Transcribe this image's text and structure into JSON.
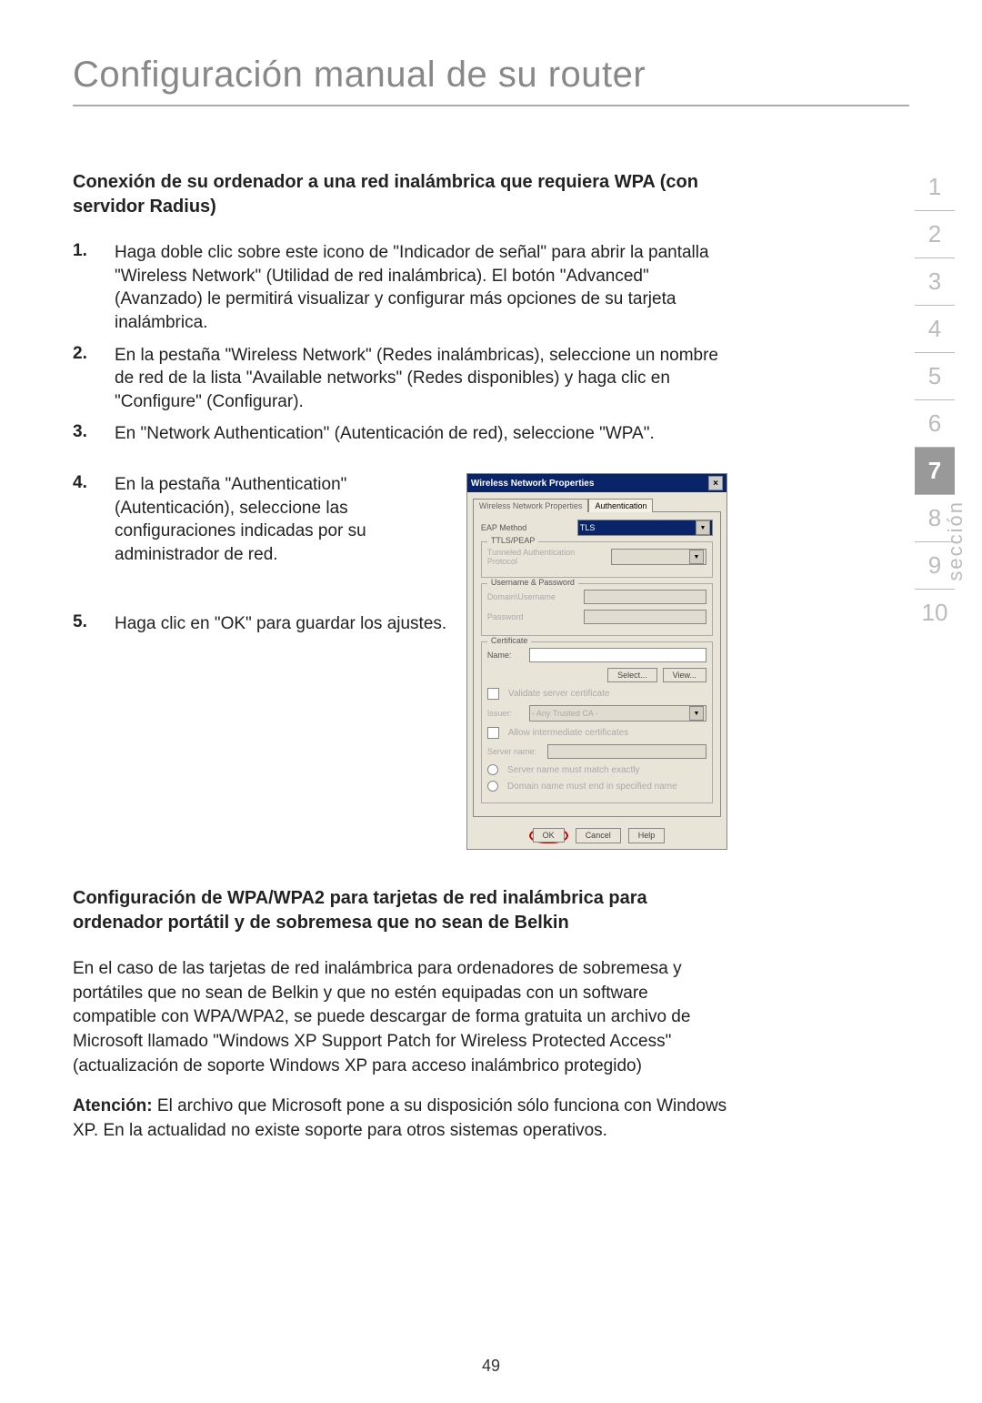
{
  "title": "Configuración manual de su router",
  "subtitle1": "Conexión de su ordenador a una red inalámbrica que requiera WPA (con servidor Radius)",
  "steps": [
    "Haga doble clic sobre este icono de \"Indicador de señal\" para abrir la pantalla \"Wireless Network\" (Utilidad de red inalámbrica). El botón \"Advanced\" (Avanzado) le permitirá visualizar y configurar más opciones de su tarjeta inalámbrica.",
    "En la pestaña \"Wireless Network\" (Redes inalámbricas), seleccione un nombre de red de la lista \"Available networks\" (Redes disponibles) y haga clic en \"Configure\" (Configurar).",
    "En \"Network Authentication\" (Autenticación de red), seleccione \"WPA\".",
    "En la pestaña \"Authentication\" (Autenticación), seleccione las configuraciones indicadas por su administrador de red.",
    "Haga clic en \"OK\" para guardar los ajustes."
  ],
  "step_nums": [
    "1.",
    "2.",
    "3.",
    "4.",
    "5."
  ],
  "screenshot": {
    "window_title": "Wireless Network Properties",
    "close": "×",
    "tab1": "Wireless Network Properties",
    "tab2": "Authentication",
    "eap_method_label": "EAP Method",
    "eap_method_value": "TLS",
    "group_ttls": "TTLS/PEAP",
    "tunneled_label": "Tunneled Authentication Protocol",
    "group_userpass": "Username & Password",
    "domain_user_label": "Domain\\Username",
    "password_label": "Password",
    "group_cert": "Certificate",
    "name_label": "Name:",
    "select_btn": "Select...",
    "view_btn": "View...",
    "validate_label": "Validate server certificate",
    "issuer_label": "Issuer:",
    "issuer_value": "- Any Trusted CA -",
    "allow_intermediate": "Allow intermediate certificates",
    "server_name_label": "Server name:",
    "server_match": "Server name must match exactly",
    "domain_end": "Domain name must end in specified name",
    "ok": "OK",
    "cancel": "Cancel",
    "help": "Help"
  },
  "subtitle2": "Configuración de WPA/WPA2 para tarjetas de red inalámbrica para ordenador portátil y de sobremesa que no sean de Belkin",
  "para1": "En el caso de las tarjetas de red inalámbrica para ordenadores de sobremesa y portátiles que no sean de Belkin y que no estén equipadas con un software compatible con WPA/WPA2, se puede descargar de forma gratuita un archivo de Microsoft llamado \"Windows XP Support Patch for Wireless Protected Access\" (actualización de soporte Windows XP para acceso inalámbrico protegido)",
  "attention_label": "Atención:",
  "para2": "El archivo que Microsoft pone a su disposición sólo funciona con Windows XP. En la actualidad no existe soporte para otros sistemas operativos.",
  "nav": [
    "1",
    "2",
    "3",
    "4",
    "5",
    "6",
    "7",
    "8",
    "9",
    "10"
  ],
  "nav_active": "7",
  "nav_label": "sección",
  "page_number": "49"
}
